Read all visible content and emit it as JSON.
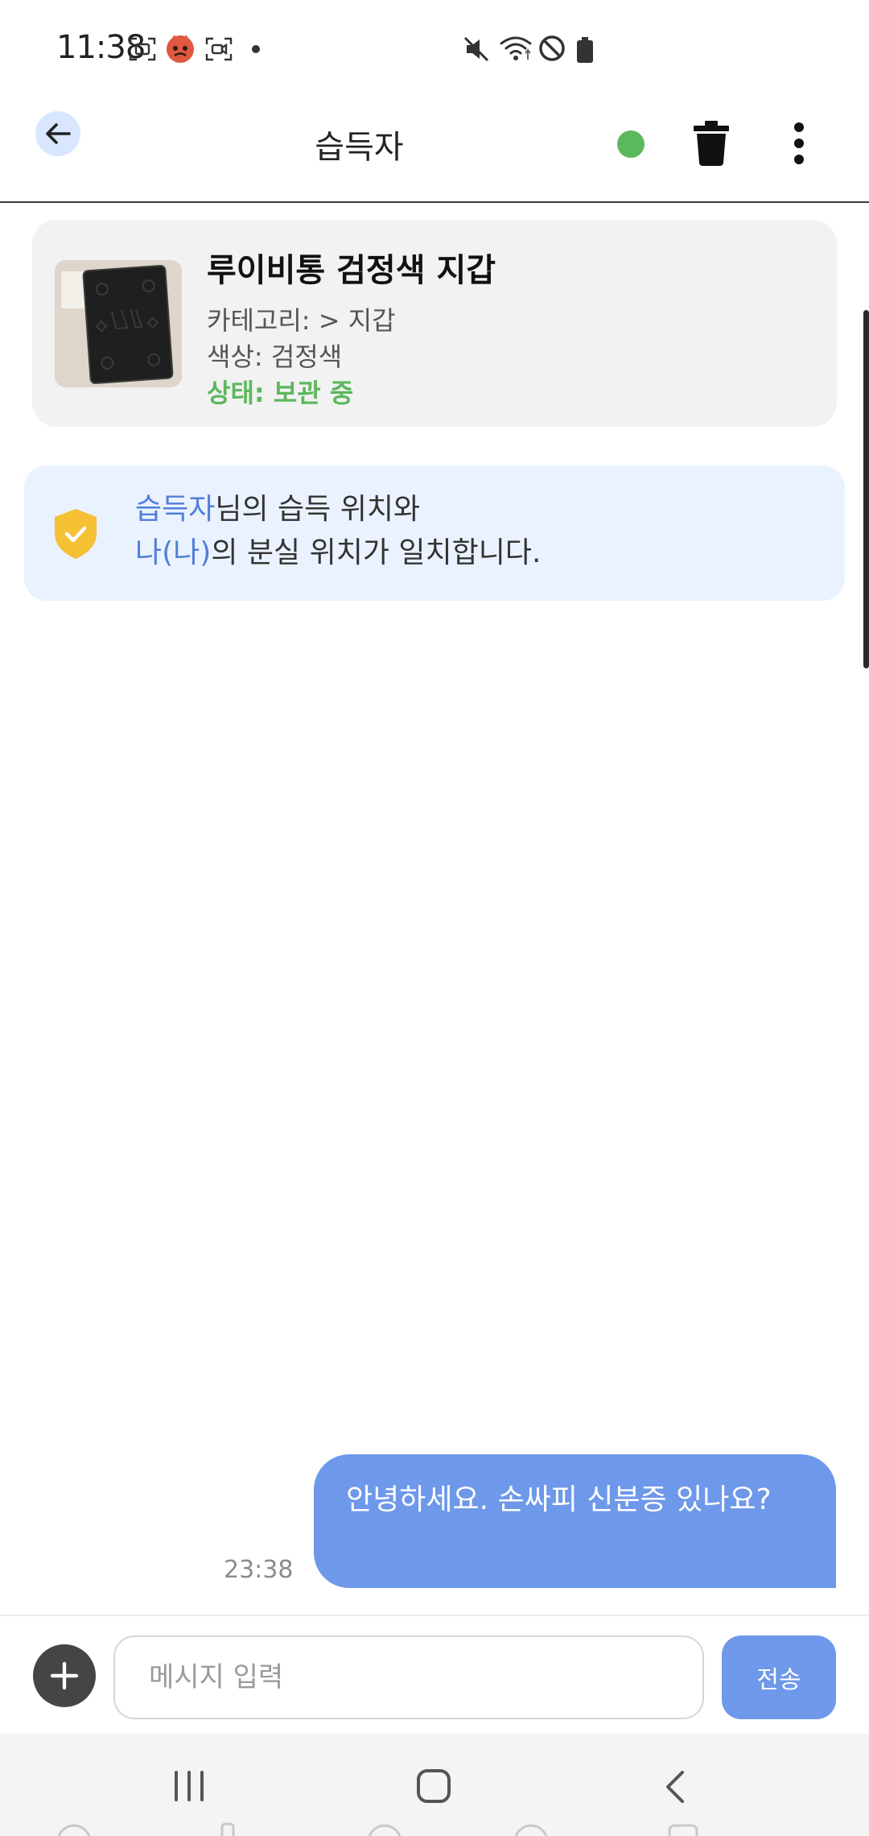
{
  "status_bar": {
    "time": "11:38"
  },
  "header": {
    "title": "습득자"
  },
  "item_card": {
    "title": "루이비통 검정색 지갑",
    "category": "카테고리:  > 지갑",
    "color": "색상: 검정색",
    "status": "상태: 보관 중"
  },
  "match_notice": {
    "finder_name": "습득자",
    "line1_rest": "님의 습득 위치와",
    "owner_name": "나(나)",
    "line2_rest": "의 분실 위치가 일치합니다."
  },
  "messages": [
    {
      "text": "안녕하세요. 손싸피 신분증 있나요?",
      "time": "23:38",
      "sender": "me"
    }
  ],
  "input": {
    "placeholder": "메시지 입력",
    "send_label": "전송"
  },
  "colors": {
    "accent": "#6e98ea",
    "status_green": "#5cb85c",
    "notice_bg": "#eaf2ff",
    "shield": "#f5c033"
  },
  "icons": {
    "back": "arrow-left-icon",
    "online": "online-status-dot",
    "delete": "trash-icon",
    "more": "more-vertical-icon",
    "shield": "shield-check-icon",
    "attach": "plus-icon"
  }
}
